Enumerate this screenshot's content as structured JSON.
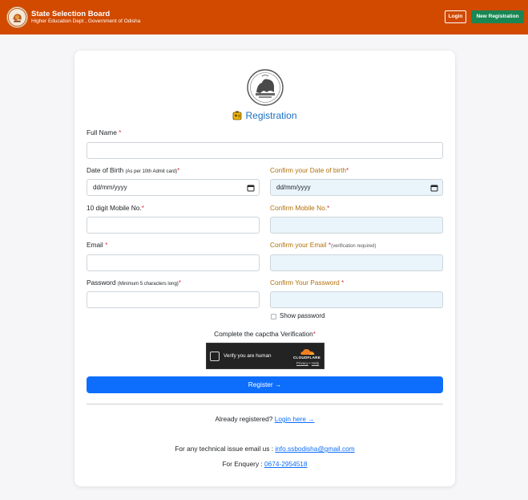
{
  "header": {
    "brand_title": "State Selection Board",
    "brand_subtitle": "Higher Education Dept , Government of Odisha",
    "login_label": "Login",
    "new_registration_label": "New Registration",
    "bg_color": "#d14a00"
  },
  "form": {
    "title": "Registration",
    "full_name": {
      "label": "Full Name",
      "required_mark": "*",
      "value": ""
    },
    "dob": {
      "label": "Date of Birth",
      "note": "(As per 10th Admit card)",
      "required_mark": "*",
      "value": "dd/mm/yyyy"
    },
    "confirm_dob": {
      "label": "Confirm your Date of birth",
      "required_mark": "*",
      "value": "dd/mm/yyyy"
    },
    "mobile": {
      "label": "10 digit Mobile No.",
      "required_mark": "*",
      "value": ""
    },
    "confirm_mobile": {
      "label": "Confirm Mobile No.",
      "required_mark": "*",
      "value": ""
    },
    "email": {
      "label": "Email",
      "required_mark": "*",
      "value": ""
    },
    "confirm_email": {
      "label": "Confirm your Email",
      "required_mark": "*",
      "note": "(verification required)",
      "value": ""
    },
    "password": {
      "label": "Password",
      "note": "(Minimum 5 characters long)",
      "required_mark": "*",
      "value": ""
    },
    "confirm_password": {
      "label": "Confirm Your Password",
      "required_mark": "*",
      "value": ""
    },
    "show_password_label": "Show password",
    "show_password_checked": false,
    "captcha_label": "Complete the capctha Verification",
    "captcha_required_mark": "*",
    "captcha": {
      "text": "Verify you are human",
      "provider": "CLOUDFLARE",
      "privacy": "Privacy",
      "separator": "•",
      "help": "Help"
    },
    "register_label": "Register →",
    "already_registered": "Already registered?",
    "login_here": "Login here →",
    "tech_issue_text": "For any technical issue email us :",
    "tech_email": "info.ssbodisha@gmail.com",
    "enquiry_text": "For Enquery :",
    "enquiry_phone": "0674-2954518"
  },
  "colors": {
    "accent_blue": "#0d6efd",
    "title_blue": "#1a6fc4",
    "confirm_label": "#b0700a",
    "confirm_field_bg": "#e9f4fb",
    "green_button": "#198754"
  }
}
